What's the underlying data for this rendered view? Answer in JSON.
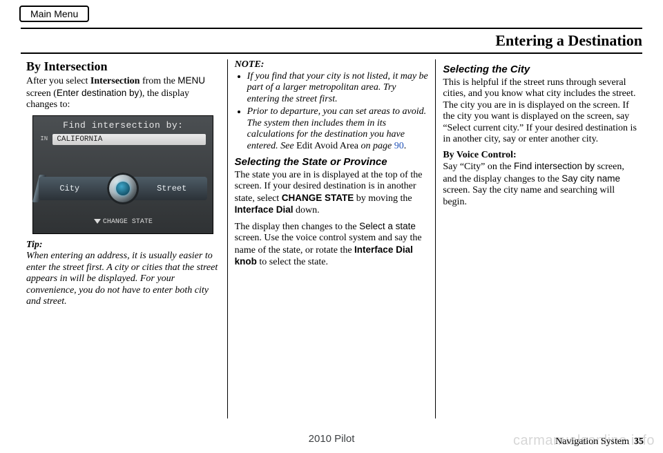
{
  "main_menu_label": "Main Menu",
  "chapter_title": "Entering a Destination",
  "col1": {
    "section_title": "By Intersection",
    "intro_a": "After you select ",
    "intro_bold": "Intersection",
    "intro_b": " from the ",
    "menu_sans": "MENU",
    "intro_c": " screen (",
    "screen_sans": "Enter destination by",
    "intro_d": "), the display changes to:",
    "navshot": {
      "title": "Find intersection by:",
      "in_label": "IN",
      "state": "CALIFORNIA",
      "left_btn": "City",
      "right_btn": "Street",
      "change_state": "CHANGE STATE"
    },
    "tip_label": "Tip:",
    "tip_body": "When entering an address, it is usually easier to enter the street first. A city or cities that the street appears in will be displayed. For your convenience, you do not have to enter both city and street."
  },
  "col2": {
    "note_label": "NOTE:",
    "note1": "If you find that your city is not listed, it may be part of a larger metropolitan area. Try entering the street first.",
    "note2_a": "Prior to departure, you can set areas to avoid. The system then includes them in its calculations for the destination you have entered. See ",
    "note2_nonitalic": "Edit Avoid Area",
    "note2_b": " on page",
    "note2_page": "90",
    "note2_c": ".",
    "sub1": "Selecting the State or Province",
    "p1_a": "The state you are in is displayed at the top of the screen. If your desired destination is in another state, select ",
    "p1_bold1": "CHANGE STATE",
    "p1_b": " by moving the ",
    "p1_bold2": "Interface Dial",
    "p1_c": " down.",
    "p2_a": "The display then changes to the ",
    "p2_sans": "Select a state",
    "p2_b": " screen. Use the voice control system and say the name of the state, or rotate the ",
    "p2_bold": "Interface Dial knob",
    "p2_c": " to select the state."
  },
  "col3": {
    "sub": "Selecting the City",
    "p1": "This is helpful if the street runs through several cities, and you know what city includes the street. The city you are in is displayed on the screen. If the city you want is displayed on the screen, say “Select current city.” If your desired destination is in another city, say or enter another city.",
    "voice_label": "By Voice Control:",
    "p2_a": "Say “City” on the ",
    "p2_sans1": "Find intersection by",
    "p2_b": " screen, and the display changes to the ",
    "p2_sans2": "Say city name",
    "p2_c": " screen. Say the city name and searching will begin."
  },
  "footer": {
    "model": "2010 Pilot",
    "section": "Navigation System",
    "page": "35",
    "watermark": "carmanualsonline.info"
  }
}
